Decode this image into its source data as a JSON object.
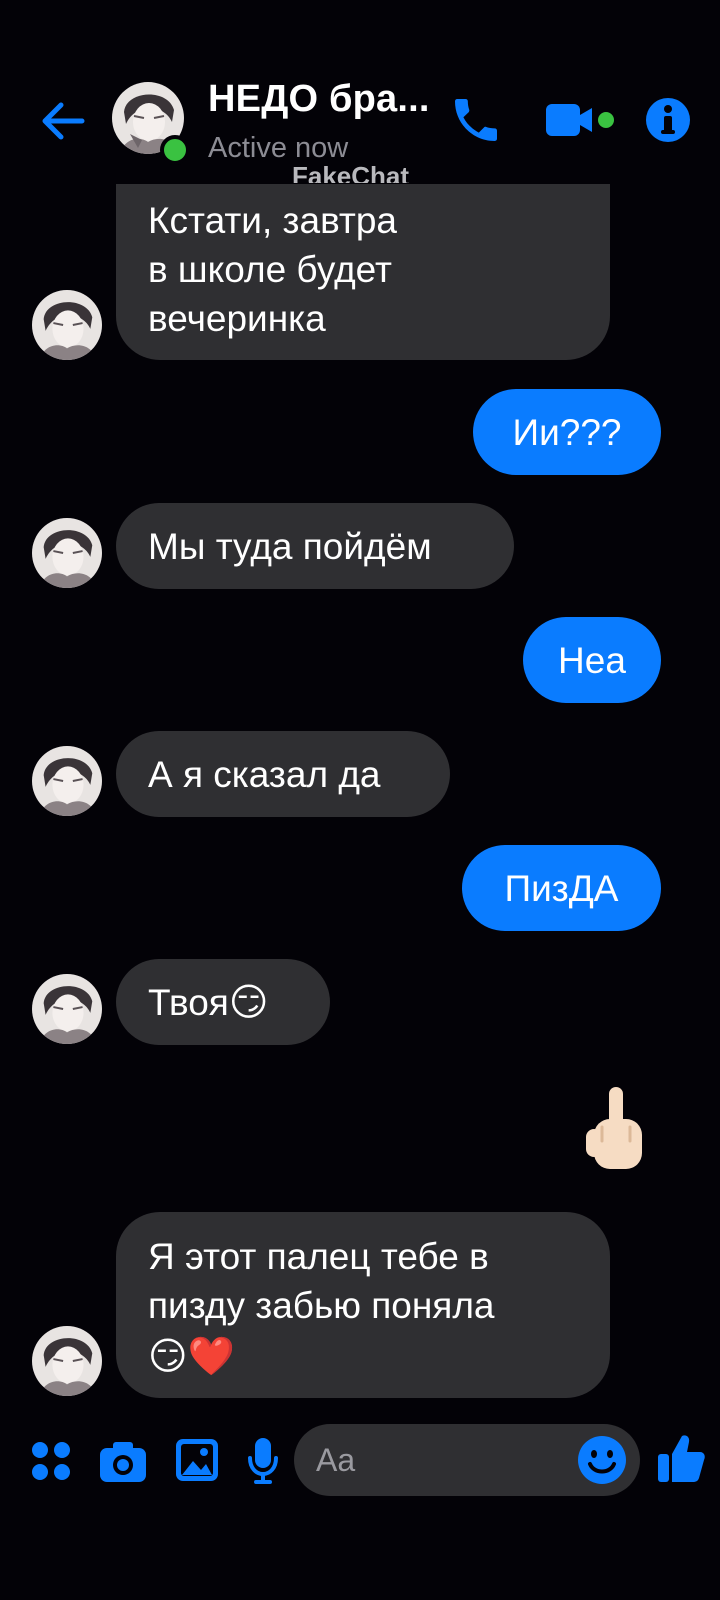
{
  "header": {
    "contact_name": "НЕДО бра...",
    "status": "Active now",
    "watermark": "FakeChat"
  },
  "messages": [
    {
      "side": "in",
      "lines": [
        "Кстати, завтра",
        "в школе будет",
        "вечеринка"
      ]
    },
    {
      "side": "out",
      "text": "Ии???"
    },
    {
      "side": "in",
      "text": "Мы туда пойдём"
    },
    {
      "side": "out",
      "text": "Неа"
    },
    {
      "side": "in",
      "text": "А я сказал да"
    },
    {
      "side": "out",
      "text": "ПизДА"
    },
    {
      "side": "in",
      "text": "Твоя",
      "emoji": "😏"
    },
    {
      "side": "out",
      "emoji": "🖕"
    },
    {
      "side": "in",
      "lines": [
        "Я этот палец тебе в",
        "пизду забью поняла"
      ],
      "emoji": "😏❤️"
    }
  ],
  "composer": {
    "placeholder": "Aa",
    "icons": [
      "apps-icon",
      "camera-icon",
      "gallery-icon",
      "microphone-icon",
      "emoji-icon",
      "thumbs-up-icon"
    ]
  },
  "colors": {
    "background": "#030207",
    "accent": "#0a7cff",
    "incoming_bubble": "#2f2f32",
    "online": "#3ac241"
  }
}
